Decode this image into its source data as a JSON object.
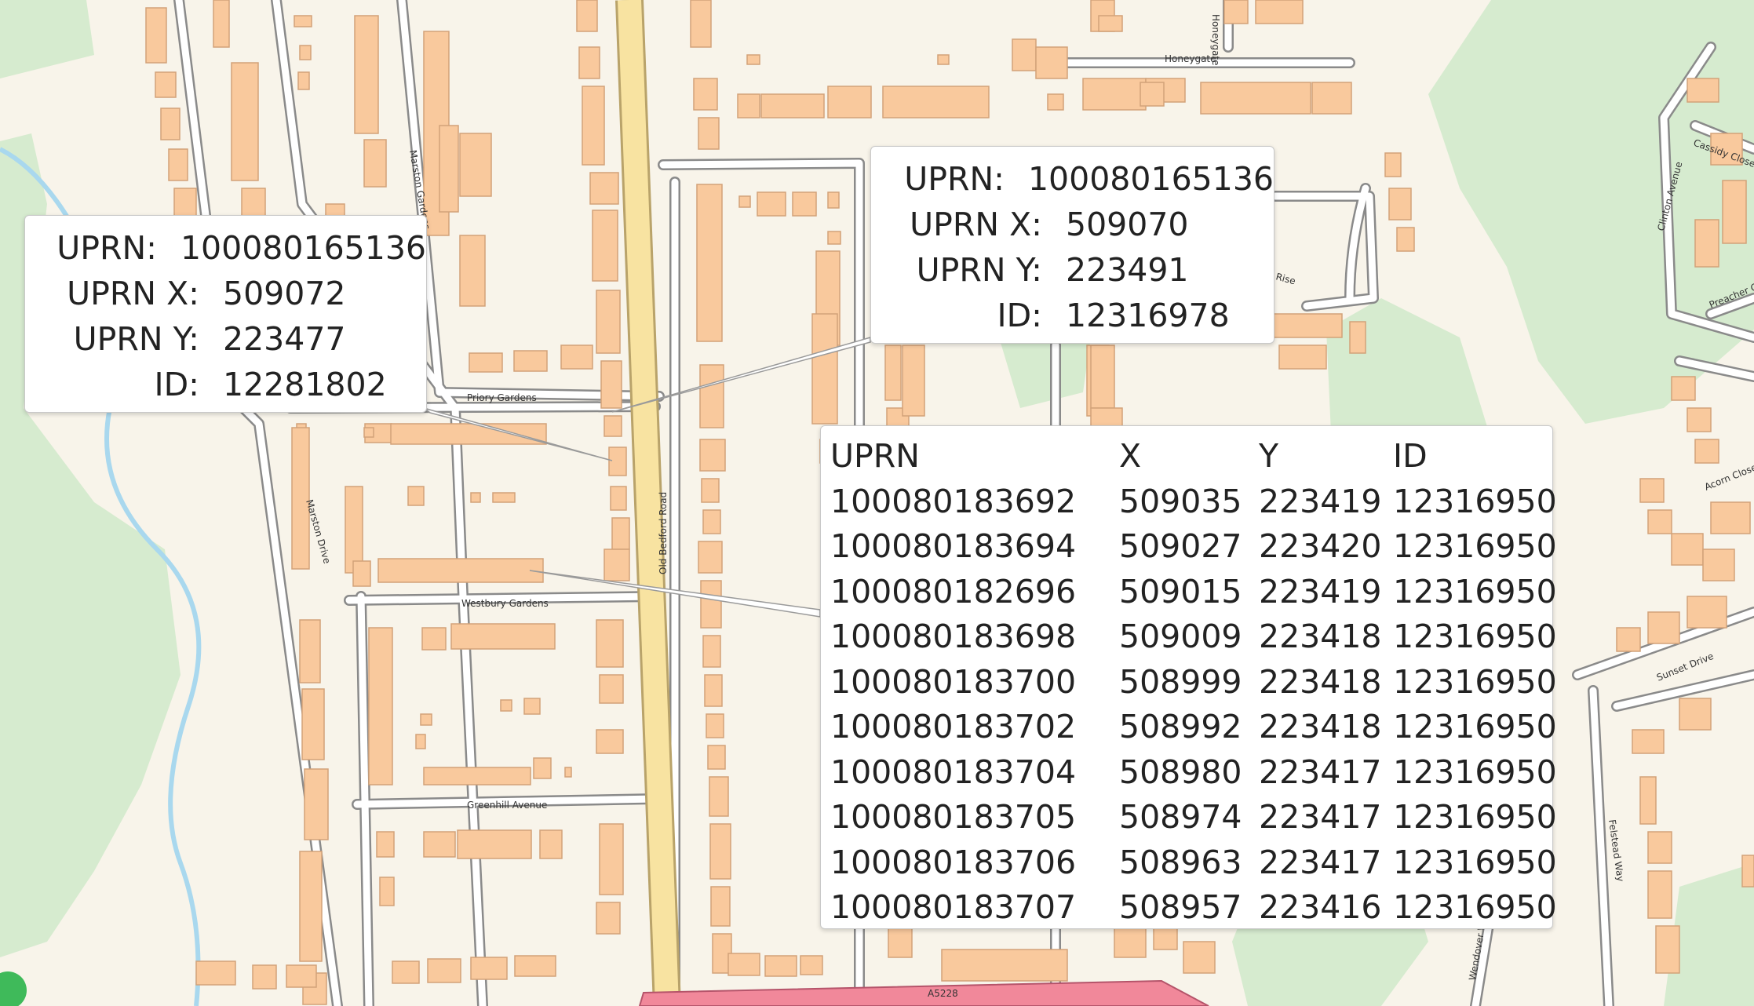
{
  "colors": {
    "background": "#f8f4ea",
    "green_area": "#d6ebcf",
    "building": "#f9c99d",
    "building_border": "#d2a279",
    "road_casing": "#8a8a8a",
    "road_fill": "#ffffff",
    "main_road": "#f8e3a1",
    "trunk_road": "#f1889a",
    "stream": "#a9d8ee"
  },
  "streets": {
    "honeygate_1": "Honeygate",
    "honeygate_2": "Honeygate",
    "marston_gardens": "Marston Gardens",
    "priory_gardens": "Priory Gardens",
    "marston_drive": "Marston Drive",
    "old_bedford_road": "Old Bedford Road",
    "westbury_gardens": "Westbury Gardens",
    "greenhill_avenue": "Greenhill Avenue",
    "a5228": "A5228",
    "cassidy_close": "Cassidy Close",
    "clinton_avenue": "Clinton Avenue",
    "preacher_close": "Preacher Close",
    "acorn_close": "Acorn Close",
    "sunset_drive": "Sunset Drive",
    "felstead_way": "Felstead Way",
    "wendover_way": "Wendover Way",
    "rise": "Rise"
  },
  "popups": {
    "left": {
      "rows": [
        {
          "label": "UPRN:",
          "value": "100080165136"
        },
        {
          "label": "UPRN X:",
          "value": "509072"
        },
        {
          "label": "UPRN Y:",
          "value": "223477"
        },
        {
          "label": "ID:",
          "value": "12281802"
        }
      ]
    },
    "middle": {
      "rows": [
        {
          "label": "UPRN:",
          "value": "100080165136"
        },
        {
          "label": "UPRN X:",
          "value": "509070"
        },
        {
          "label": "UPRN Y:",
          "value": "223491"
        },
        {
          "label": "ID:",
          "value": "12316978"
        }
      ]
    },
    "table": {
      "headers": [
        "UPRN",
        "X",
        "Y",
        "ID"
      ],
      "rows": [
        [
          "100080183692",
          "509035",
          "223419",
          "12316950"
        ],
        [
          "100080183694",
          "509027",
          "223420",
          "12316950"
        ],
        [
          "100080182696",
          "509015",
          "223419",
          "12316950"
        ],
        [
          "100080183698",
          "509009",
          "223418",
          "12316950"
        ],
        [
          "100080183700",
          "508999",
          "223418",
          "12316950"
        ],
        [
          "100080183702",
          "508992",
          "223418",
          "12316950"
        ],
        [
          "100080183704",
          "508980",
          "223417",
          "12316950"
        ],
        [
          "100080183705",
          "508974",
          "223417",
          "12316950"
        ],
        [
          "100080183706",
          "508963",
          "223417",
          "12316950"
        ],
        [
          "100080183707",
          "508957",
          "223416",
          "12316950"
        ]
      ]
    }
  }
}
